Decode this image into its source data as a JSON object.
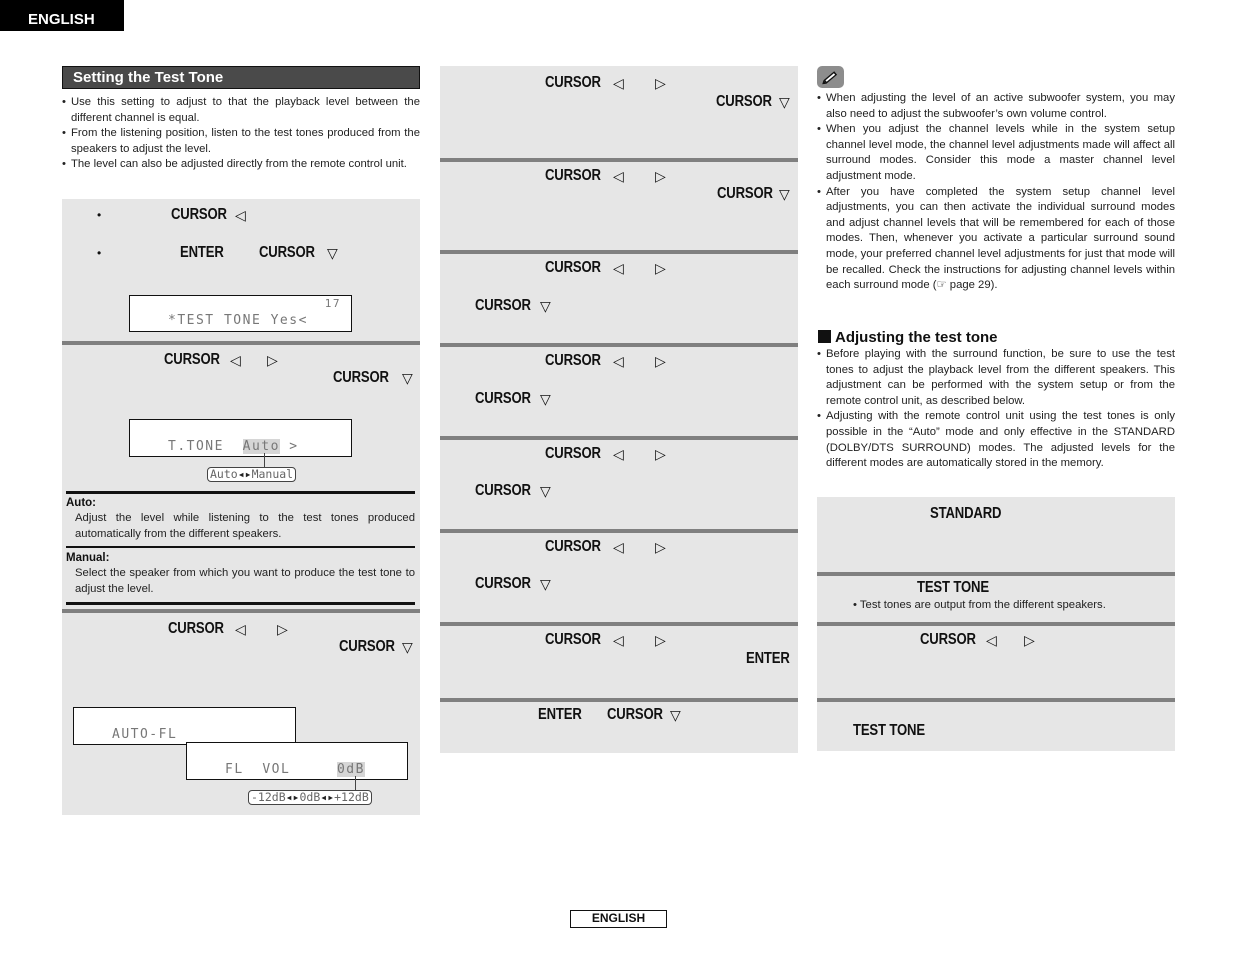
{
  "header": {
    "language_tab": "ENGLISH"
  },
  "left_column": {
    "section_title": "Setting the Test Tone",
    "intro_bullets": [
      "Use this setting to adjust to that the playback level between the different channel is equal.",
      "From the listening position, listen to the test tones produced from the speakers to adjust the level.",
      "The level can also be adjusted directly from the remote control unit."
    ],
    "step1": {
      "line1": {
        "key": "CURSOR",
        "arrow": "◁"
      },
      "line2": {
        "key1": "ENTER",
        "key2": "CURSOR",
        "arrow": "▽"
      },
      "lcd": {
        "top_right": "17",
        "text": "*TEST TONE Yes<"
      }
    },
    "step2": {
      "line1": {
        "key": "CURSOR",
        "arrow_left": "◁",
        "arrow_right": "▷"
      },
      "line2": {
        "key": "CURSOR",
        "arrow": "▽"
      },
      "lcd": {
        "label": "T.TONE",
        "value": "Auto",
        "suffix": ">"
      },
      "options_callout": {
        "option_a": "Auto",
        "separator": "◂▸",
        "option_b": "Manual"
      },
      "definitions": [
        {
          "term": "Auto:",
          "text": "Adjust the level while listening to the test tones produced automatically from the different speakers."
        },
        {
          "term": "Manual:",
          "text": "Select the speaker from which you want to produce the test tone to adjust the level."
        }
      ]
    },
    "step3": {
      "line1": {
        "key": "CURSOR",
        "arrow_left": "◁",
        "arrow_right": "▷"
      },
      "line2": {
        "key": "CURSOR",
        "arrow": "▽"
      },
      "lcd_auto": {
        "text": "AUTO-FL"
      },
      "lcd_manual": {
        "channel": "FL",
        "label": "VOL",
        "value": "0dB"
      },
      "range_callout": {
        "min": "-12dB",
        "mid": "0dB",
        "max": "+12dB",
        "separator": "◂▸"
      }
    }
  },
  "middle_column": {
    "steps": [
      {
        "key1": "CURSOR",
        "arrow_left": "◁",
        "arrow_right": "▷",
        "key2": "CURSOR",
        "arrow2": "▽"
      },
      {
        "key1": "CURSOR",
        "arrow_left": "◁",
        "arrow_right": "▷",
        "key2": "CURSOR",
        "arrow2": "▽"
      },
      {
        "key1": "CURSOR",
        "arrow_left": "◁",
        "arrow_right": "▷",
        "key2": "CURSOR",
        "arrow2": "▽"
      },
      {
        "key1": "CURSOR",
        "arrow_left": "◁",
        "arrow_right": "▷",
        "key2": "CURSOR",
        "arrow2": "▽"
      },
      {
        "key1": "CURSOR",
        "arrow_left": "◁",
        "arrow_right": "▷",
        "key2": "CURSOR",
        "arrow2": "▽"
      },
      {
        "key1": "CURSOR",
        "arrow_left": "◁",
        "arrow_right": "▷",
        "key2": "CURSOR",
        "arrow2": "▽"
      },
      {
        "key1": "CURSOR",
        "arrow_left": "◁",
        "arrow_right": "▷",
        "key2": "ENTER"
      },
      {
        "key1": "ENTER",
        "key2": "CURSOR",
        "arrow2": "▽"
      }
    ]
  },
  "right_column": {
    "note_icon": "pencil-icon",
    "note_bullets": [
      "When adjusting the level of an active subwoofer system, you may also need to adjust the subwoofer’s own volume control.",
      "When you adjust the channel levels while in the system setup channel level mode, the channel level adjustments made will affect all surround modes. Consider this mode a master channel level adjustment mode.",
      "After you have completed the system setup channel level adjustments, you can then activate the individual surround modes and adjust channel levels that will be remembered for each of those modes. Then, whenever you activate a particular surround sound mode, your preferred channel level adjustments for just that mode will be recalled. Check the instructions for adjusting channel levels within each surround mode (☞ page 29)."
    ],
    "subheading": "Adjusting the test tone",
    "sub_bullets": [
      "Before playing with the surround function, be sure to use the test tones to adjust the playback level from the different speakers. This adjustment can be performed with the system setup or from the remote control unit, as described below.",
      "Adjusting with the remote control unit using the test tones is only possible in the “Auto” mode and only effective in the STANDARD (DOLBY/DTS SURROUND) modes. The adjusted levels for the different modes are automatically stored in the memory."
    ],
    "steps": {
      "s1": {
        "key": "STANDARD"
      },
      "s2": {
        "key": "TEST TONE",
        "note": "Test tones are output from the different speakers."
      },
      "s3": {
        "key": "CURSOR",
        "arrow_left": "◁",
        "arrow_right": "▷"
      },
      "s4": {
        "key": "TEST TONE"
      }
    }
  },
  "footer": {
    "language_tag": "ENGLISH"
  }
}
